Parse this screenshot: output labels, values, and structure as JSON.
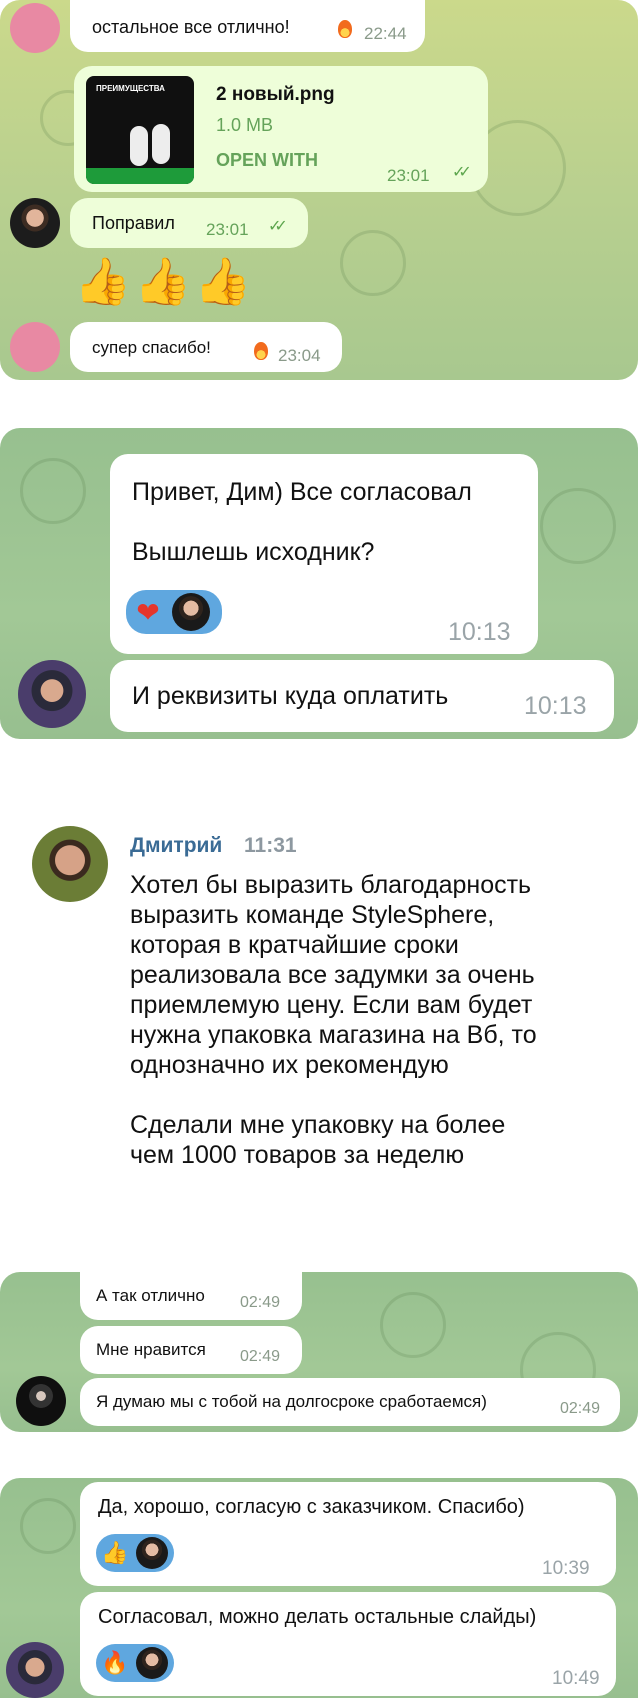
{
  "shot1": {
    "msg_top": {
      "text": "остальное все отлично!",
      "reaction": "fire-icon",
      "time": "22:44"
    },
    "file_msg": {
      "thumb_title": "ПРЕИМУЩЕСТВА",
      "filename": "2 новый.png",
      "size": "1.0 MB",
      "action": "OPEN WITH",
      "time": "23:01"
    },
    "msg_fixed": {
      "text": "Поправил",
      "time": "23:01"
    },
    "thumbs": [
      "👍",
      "👍",
      "👍"
    ],
    "msg_thanks": {
      "text": "супер спасибо!",
      "reaction": "fire-icon",
      "time": "23:04"
    }
  },
  "shot2": {
    "msg1": {
      "line1": "Привет, Дим) Все согласовал",
      "line2": "Вышлешь исходник?",
      "time": "10:13"
    },
    "msg2": {
      "text": "И реквизиты куда оплатить",
      "time": "10:13"
    }
  },
  "review": {
    "author": "Дмитрий",
    "time": "11:31",
    "lines": [
      "Хотел бы выразить благодарность",
      "выразить команде StyleSphere,",
      "которая в кратчайшие сроки",
      "реализовала все задумки за очень",
      "приемлемую цену. Если вам будет",
      "нужна упаковка магазина на Вб, то",
      "однозначно их рекомендую"
    ],
    "lines2": [
      "Сделали мне упаковку на более",
      "чем 1000 товаров за неделю"
    ]
  },
  "shot3": {
    "msgs": [
      {
        "text": "А так отлично",
        "time": "02:49"
      },
      {
        "text": "Мне нравится",
        "time": "02:49"
      },
      {
        "text": "Я думаю мы с тобой на долгосроке сработаемся)",
        "time": "02:49"
      }
    ]
  },
  "shot4": {
    "msg1": {
      "text": "Да, хорошо, согласую с заказчиком. Спасибо)",
      "reaction": "👍",
      "time": "10:39"
    },
    "msg2": {
      "text": "Согласовал, можно делать остальные слайды)",
      "reaction": "🔥",
      "time": "10:49"
    }
  },
  "colors": {
    "bubble_out": "#eefed9",
    "bubble_in": "#ffffff",
    "accent_green": "#65a35a",
    "name_blue": "#3a6b95",
    "reaction_blue": "#5fa7df"
  }
}
